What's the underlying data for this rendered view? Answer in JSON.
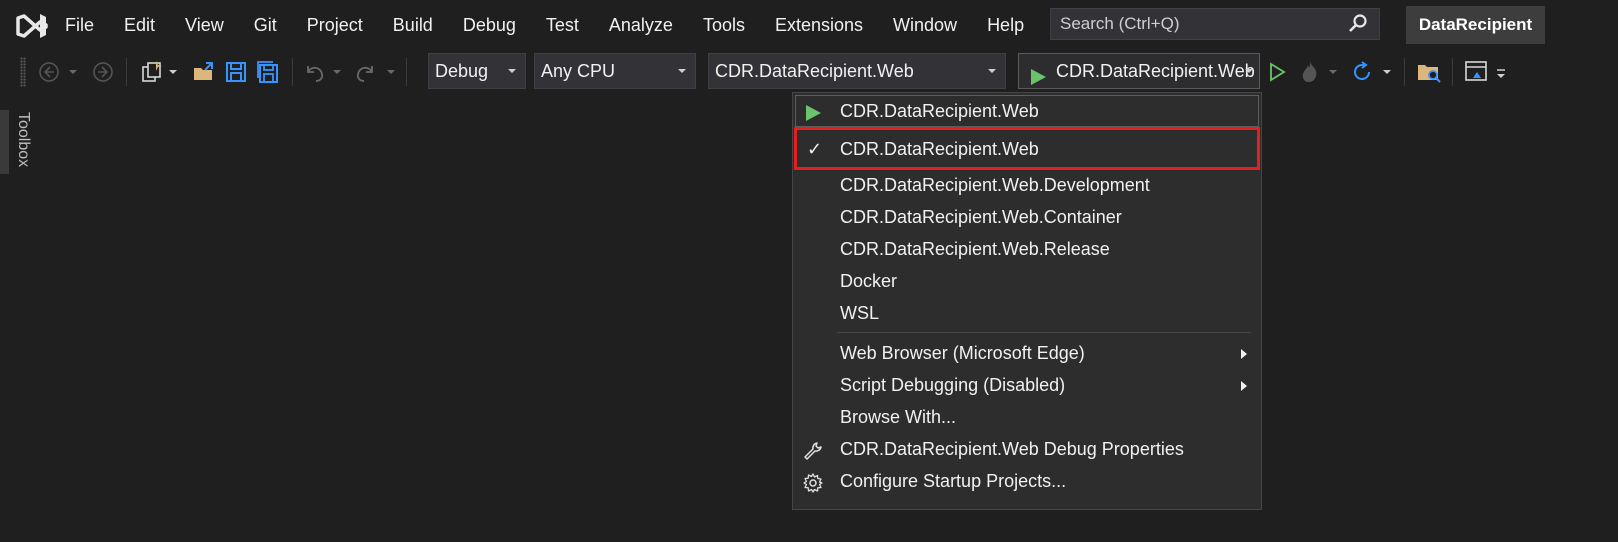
{
  "menubar": {
    "items": [
      "File",
      "Edit",
      "View",
      "Git",
      "Project",
      "Build",
      "Debug",
      "Test",
      "Analyze",
      "Tools",
      "Extensions",
      "Window",
      "Help"
    ],
    "search_placeholder": "Search (Ctrl+Q)",
    "solution_name": "DataRecipient"
  },
  "toolbar": {
    "configuration": "Debug",
    "platform": "Any CPU",
    "startup_project": "CDR.DataRecipient.Web",
    "start_button_label": "CDR.DataRecipient.Web"
  },
  "toolbox": {
    "label": "Toolbox"
  },
  "dropdown": {
    "top_item": "CDR.DataRecipient.Web",
    "profiles": [
      {
        "label": "CDR.DataRecipient.Web",
        "checked": true
      },
      {
        "label": "CDR.DataRecipient.Web.Development",
        "checked": false
      },
      {
        "label": "CDR.DataRecipient.Web.Container",
        "checked": false
      },
      {
        "label": "CDR.DataRecipient.Web.Release",
        "checked": false
      },
      {
        "label": "Docker",
        "checked": false
      },
      {
        "label": "WSL",
        "checked": false
      }
    ],
    "options": [
      {
        "label": "Web Browser (Microsoft Edge)",
        "submenu": true
      },
      {
        "label": "Script Debugging (Disabled)",
        "submenu": true
      },
      {
        "label": "Browse With...",
        "submenu": false
      },
      {
        "label": "CDR.DataRecipient.Web Debug Properties",
        "icon": "wrench-icon"
      },
      {
        "label": "Configure Startup Projects...",
        "icon": "gear-icon"
      }
    ],
    "check_mark": "✓"
  },
  "colors": {
    "background": "#1f1f1f",
    "play_green": "#6bc46b",
    "highlight_red": "#e51f1f",
    "accent_blue": "#3794ff",
    "folder_yellow": "#dcb67a"
  }
}
